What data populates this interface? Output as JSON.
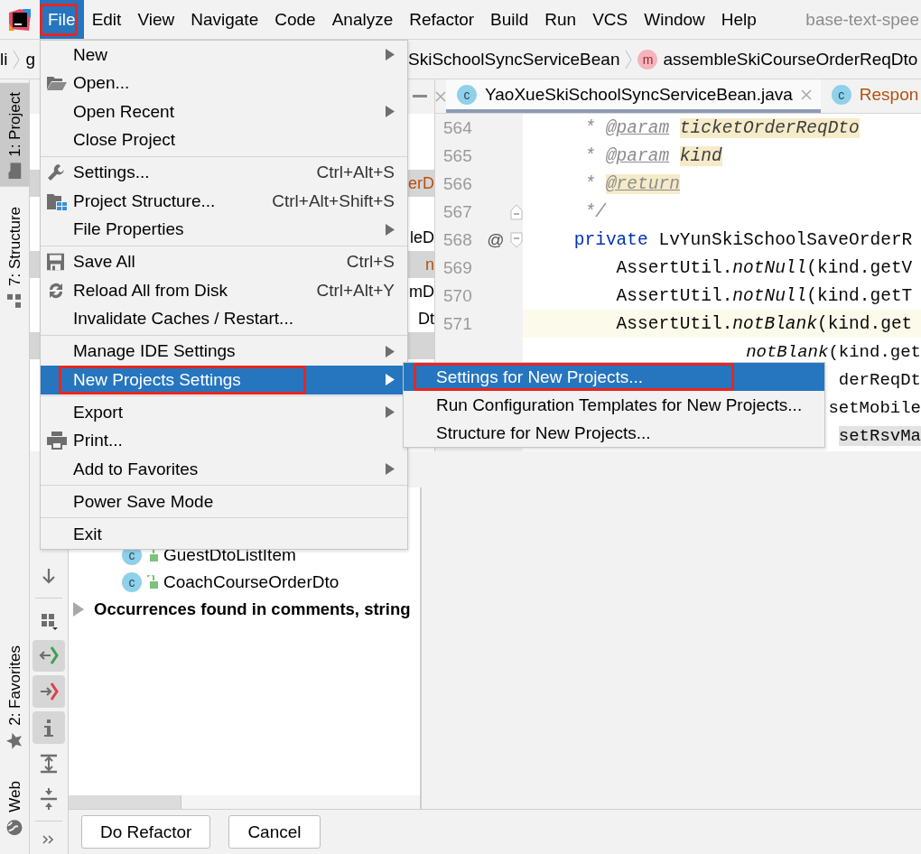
{
  "menubar": {
    "items": [
      {
        "label": "File",
        "selected": true,
        "outlined": true
      },
      {
        "label": "Edit",
        "selected": false,
        "outlined": false
      },
      {
        "label": "View",
        "selected": false,
        "outlined": false
      },
      {
        "label": "Navigate",
        "selected": false,
        "outlined": false
      },
      {
        "label": "Code",
        "selected": false,
        "outlined": false
      },
      {
        "label": "Analyze",
        "selected": false,
        "outlined": false
      },
      {
        "label": "Refactor",
        "selected": false,
        "outlined": false
      },
      {
        "label": "Build",
        "selected": false,
        "outlined": false
      },
      {
        "label": "Run",
        "selected": false,
        "outlined": false
      },
      {
        "label": "VCS",
        "selected": false,
        "outlined": false
      },
      {
        "label": "Window",
        "selected": false,
        "outlined": false
      },
      {
        "label": "Help",
        "selected": false,
        "outlined": false
      }
    ],
    "title": "base-text-spee"
  },
  "breadcrumb": {
    "lead": [
      "li",
      "g"
    ],
    "crumbs": [
      {
        "label": "SkiSchoolSyncServiceBean"
      },
      {
        "label": "assembleSkiCourseOrderReqDto",
        "badge": "m"
      }
    ]
  },
  "tool_tabs_top": [
    {
      "label": "1: Project",
      "selected": true,
      "kind": "folder"
    },
    {
      "label": "7: Structure",
      "selected": false,
      "kind": "structure"
    }
  ],
  "tool_tabs_bottom": [
    {
      "label": "2: Favorites",
      "selected": false,
      "kind": "star"
    },
    {
      "label": "Web",
      "selected": false,
      "kind": "globe"
    }
  ],
  "project_panel": {
    "rows": [
      {
        "highlighted": false
      },
      {
        "highlighted": false
      },
      {
        "text": "erD",
        "highlighted": true,
        "color": "#b5500f"
      },
      {
        "highlighted": false
      },
      {
        "text": "leD",
        "highlighted": false,
        "color": "#000000"
      },
      {
        "text": "n",
        "highlighted": true,
        "color": "#b5500f"
      },
      {
        "text": "mD",
        "highlighted": false,
        "color": "#000000"
      },
      {
        "text": "Dt",
        "highlighted": false,
        "color": "#000000"
      },
      {
        "highlighted": true
      }
    ]
  },
  "editor": {
    "tabs": [
      {
        "label": "YaoXueSkiSchoolSyncServiceBean.java",
        "badge": "c",
        "selected": true,
        "color": "#000000"
      },
      {
        "label": "Respon",
        "badge": "c",
        "selected": false,
        "color": "#b5500f"
      }
    ],
    "lines": [
      {
        "kind": "full",
        "number": "564",
        "current": false,
        "tokens": [
          {
            "text": "     * ",
            "kind": "comment"
          },
          {
            "text": "@param",
            "kind": "doctag"
          },
          {
            "text": "ticketOrderReqDto",
            "kind": "param"
          }
        ]
      },
      {
        "kind": "full",
        "number": "565",
        "current": false,
        "tokens": [
          {
            "text": "     * ",
            "kind": "comment"
          },
          {
            "text": "@param",
            "kind": "doctag"
          },
          {
            "text": "kind",
            "kind": "param"
          }
        ]
      },
      {
        "kind": "full",
        "number": "566",
        "current": false,
        "tokens": [
          {
            "text": "     * ",
            "kind": "comment"
          },
          {
            "text": "@return",
            "kind": "doctag-hl"
          }
        ]
      },
      {
        "kind": "full",
        "number": "567",
        "current": false,
        "fold": {
          "kind": "end"
        },
        "tokens": [
          {
            "text": "     */",
            "kind": "comment"
          }
        ]
      },
      {
        "kind": "full",
        "number": "568",
        "current": false,
        "fold": {
          "kind": "start"
        },
        "marker": "@",
        "tokens": [
          {
            "text": "    private",
            "kind": "keyword"
          },
          {
            "text": " LvYunSkiSchoolSaveOrderR",
            "kind": "plain"
          }
        ]
      },
      {
        "kind": "full",
        "number": "569",
        "current": false,
        "tokens": [
          {
            "text": "        AssertUtil.",
            "kind": "plain"
          },
          {
            "text": "notNull",
            "kind": "static"
          },
          {
            "text": "(kind.getV",
            "kind": "plain"
          }
        ]
      },
      {
        "kind": "full",
        "number": "570",
        "current": false,
        "tokens": [
          {
            "text": "        AssertUtil.",
            "kind": "plain"
          },
          {
            "text": "notNull",
            "kind": "static"
          },
          {
            "text": "(kind.getT",
            "kind": "plain"
          }
        ]
      },
      {
        "kind": "full",
        "number": "571",
        "current": true,
        "tokens": [
          {
            "text": "        AssertUtil.",
            "kind": "plain"
          },
          {
            "text": "notBlank",
            "kind": "static"
          },
          {
            "text": "(kind.get",
            "kind": "plain"
          }
        ]
      },
      {
        "kind": "tail",
        "tokens": [
          {
            "text": "notBlank",
            "kind": "static"
          },
          {
            "text": "(kind.get",
            "kind": "plain"
          }
        ]
      },
      {
        "kind": "tail",
        "tokens": [
          {
            "text": "derReqDt",
            "kind": "plain"
          }
        ]
      },
      {
        "kind": "tail",
        "tokens": [
          {
            "text": "setMobile",
            "kind": "plain"
          }
        ]
      },
      {
        "kind": "tail",
        "tokens": [
          {
            "text": "setRsvMa",
            "kind": "match"
          }
        ]
      }
    ]
  },
  "preview": {
    "toolbar": [
      {
        "kind": "down",
        "pressed": false
      },
      {
        "kind": "separator"
      },
      {
        "kind": "grid",
        "pressed": false
      },
      {
        "kind": "import",
        "pressed": true
      },
      {
        "kind": "export",
        "pressed": true
      },
      {
        "kind": "info",
        "pressed": true
      },
      {
        "kind": "expand",
        "pressed": false
      },
      {
        "kind": "collapse",
        "pressed": false
      },
      {
        "kind": "separator"
      },
      {
        "kind": "more",
        "pressed": false
      }
    ],
    "tree": [
      {
        "label": "GuestDtoListItem",
        "kind": "class",
        "badge": "c"
      },
      {
        "label": "CoachCourseOrderDto",
        "kind": "class",
        "badge": "c"
      },
      {
        "label": "Occurrences found in comments, string",
        "kind": "group",
        "expanded": false
      }
    ],
    "buttons": [
      {
        "label": "Do Refactor"
      },
      {
        "label": "Cancel"
      }
    ]
  },
  "file_menu": {
    "groups": [
      [
        {
          "label": "New",
          "submenu": true,
          "selected": false,
          "outlined": false
        },
        {
          "label": "Open...",
          "kind": "folder-open",
          "submenu": false,
          "selected": false,
          "outlined": false
        },
        {
          "label": "Open Recent",
          "submenu": true,
          "selected": false,
          "outlined": false
        },
        {
          "label": "Close Project",
          "submenu": false,
          "selected": false,
          "outlined": false
        }
      ],
      [
        {
          "label": "Settings...",
          "kind": "wrench",
          "shortcut": "Ctrl+Alt+S",
          "submenu": false,
          "selected": false,
          "outlined": false
        },
        {
          "label": "Project Structure...",
          "kind": "structure",
          "shortcut": "Ctrl+Alt+Shift+S",
          "submenu": false,
          "selected": false,
          "outlined": false
        },
        {
          "label": "File Properties",
          "submenu": true,
          "selected": false,
          "outlined": false
        }
      ],
      [
        {
          "label": "Save All",
          "kind": "disk",
          "shortcut": "Ctrl+S",
          "submenu": false,
          "selected": false,
          "outlined": false
        },
        {
          "label": "Reload All from Disk",
          "kind": "reload",
          "shortcut": "Ctrl+Alt+Y",
          "submenu": false,
          "selected": false,
          "outlined": false
        },
        {
          "label": "Invalidate Caches / Restart...",
          "submenu": false,
          "selected": false,
          "outlined": false
        }
      ],
      [
        {
          "label": "Manage IDE Settings",
          "submenu": true,
          "selected": false,
          "outlined": false
        },
        {
          "label": "New Projects Settings",
          "submenu": true,
          "selected": true,
          "outlined": true
        }
      ],
      [
        {
          "label": "Export",
          "submenu": true,
          "selected": false,
          "outlined": false
        },
        {
          "label": "Print...",
          "kind": "printer",
          "submenu": false,
          "selected": false,
          "outlined": false
        },
        {
          "label": "Add to Favorites",
          "submenu": true,
          "selected": false,
          "outlined": false
        }
      ],
      [
        {
          "label": "Power Save Mode",
          "submenu": false,
          "selected": false,
          "outlined": false
        }
      ],
      [
        {
          "label": "Exit",
          "submenu": false,
          "selected": false,
          "outlined": false
        }
      ]
    ]
  },
  "submenu": {
    "items": [
      {
        "label": "Settings for New Projects...",
        "selected": true,
        "outlined": true
      },
      {
        "label": "Run Configuration Templates for New Projects...",
        "selected": false,
        "outlined": false
      },
      {
        "label": "Structure for New Projects...",
        "selected": false,
        "outlined": false
      }
    ]
  }
}
